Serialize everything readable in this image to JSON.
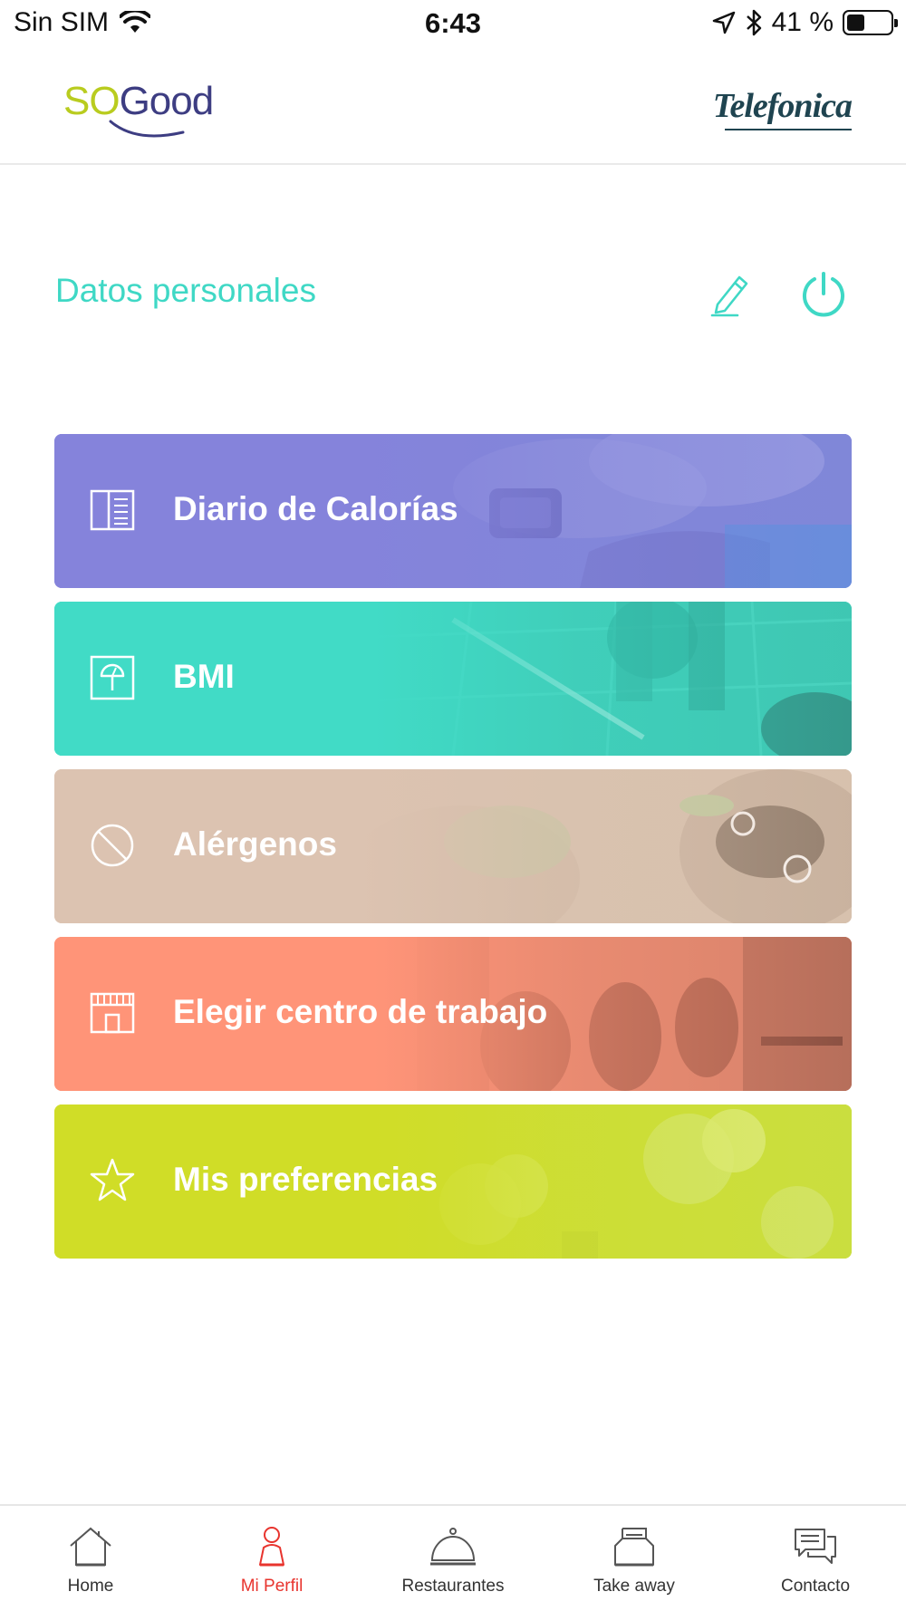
{
  "status_bar": {
    "carrier": "Sin SIM",
    "time": "6:43",
    "battery_text": "41 %",
    "battery_level": 0.41
  },
  "header": {
    "brand_left_a": "SO",
    "brand_left_b": "Good",
    "brand_right": "Telefonica"
  },
  "section": {
    "title": "Datos personales"
  },
  "menu": [
    {
      "label": "Diario de Calorías",
      "icon": "journal-icon",
      "color": "#8583db"
    },
    {
      "label": "BMI",
      "icon": "scale-icon",
      "color": "#41dbc6"
    },
    {
      "label": "Alérgenos",
      "icon": "prohibited-icon",
      "color": "#dcc3b1"
    },
    {
      "label": "Elegir centro de trabajo",
      "icon": "storefront-icon",
      "color": "#ff9478"
    },
    {
      "label": "Mis preferencias",
      "icon": "star-icon",
      "color": "#d0dd27"
    }
  ],
  "tabs": [
    {
      "label": "Home",
      "icon": "house-icon",
      "active": false
    },
    {
      "label": "Mi Perfil",
      "icon": "person-icon",
      "active": true
    },
    {
      "label": "Restaurantes",
      "icon": "cloche-icon",
      "active": false
    },
    {
      "label": "Take away",
      "icon": "takeaway-box-icon",
      "active": false
    },
    {
      "label": "Contacto",
      "icon": "chat-bubbles-icon",
      "active": false
    }
  ],
  "colors": {
    "accent": "#3fd8c5",
    "active_tab": "#e8342e"
  }
}
